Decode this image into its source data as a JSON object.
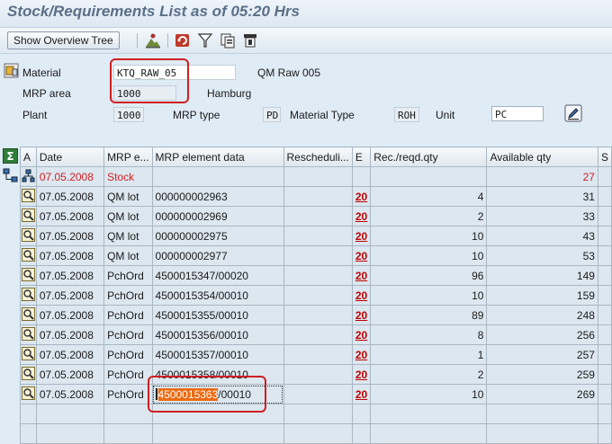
{
  "window": {
    "title": "Stock/Requirements List as of 05:20 Hrs"
  },
  "toolbar": {
    "show_overview_tree": "Show Overview Tree",
    "icons": [
      "person-mountain-icon",
      "refresh-icon",
      "filter-icon",
      "copy-icon",
      "settings-icon"
    ]
  },
  "header": {
    "material_label": "Material",
    "material_value": "KTQ_RAW_05",
    "material_desc": "QM Raw 005",
    "mrp_area_label": "MRP area",
    "mrp_area_value": "1000",
    "mrp_area_desc": "Hamburg",
    "plant_label": "Plant",
    "plant_value": "1000",
    "mrp_type_label": "MRP type",
    "mrp_type_value": "PD",
    "material_type_label": "Material Type",
    "material_type_value": "ROH",
    "unit_label": "Unit",
    "unit_value": "PC"
  },
  "grid": {
    "columns": [
      "A",
      "Date",
      "MRP e...",
      "MRP element data",
      "Rescheduli...",
      "E",
      "Rec./reqd.qty",
      "Available qty",
      "S"
    ],
    "rows": [
      {
        "date": "07.05.2008",
        "element": "Stock",
        "data": "",
        "resched": "",
        "exc": "",
        "qty": "",
        "avail": "27"
      },
      {
        "date": "07.05.2008",
        "element": "QM lot",
        "data": "000000002963",
        "resched": "",
        "exc": "20",
        "qty": "4",
        "avail": "31"
      },
      {
        "date": "07.05.2008",
        "element": "QM lot",
        "data": "000000002969",
        "resched": "",
        "exc": "20",
        "qty": "2",
        "avail": "33"
      },
      {
        "date": "07.05.2008",
        "element": "QM lot",
        "data": "000000002975",
        "resched": "",
        "exc": "20",
        "qty": "10",
        "avail": "43"
      },
      {
        "date": "07.05.2008",
        "element": "QM lot",
        "data": "000000002977",
        "resched": "",
        "exc": "20",
        "qty": "10",
        "avail": "53"
      },
      {
        "date": "07.05.2008",
        "element": "PchOrd",
        "data": "4500015347/00020",
        "resched": "",
        "exc": "20",
        "qty": "96",
        "avail": "149"
      },
      {
        "date": "07.05.2008",
        "element": "PchOrd",
        "data": "4500015354/00010",
        "resched": "",
        "exc": "20",
        "qty": "10",
        "avail": "159"
      },
      {
        "date": "07.05.2008",
        "element": "PchOrd",
        "data": "4500015355/00010",
        "resched": "",
        "exc": "20",
        "qty": "89",
        "avail": "248"
      },
      {
        "date": "07.05.2008",
        "element": "PchOrd",
        "data": "4500015356/00010",
        "resched": "",
        "exc": "20",
        "qty": "8",
        "avail": "256"
      },
      {
        "date": "07.05.2008",
        "element": "PchOrd",
        "data": "4500015357/00010",
        "resched": "",
        "exc": "20",
        "qty": "1",
        "avail": "257"
      },
      {
        "date": "07.05.2008",
        "element": "PchOrd",
        "data": "4500015358/00010",
        "resched": "",
        "exc": "20",
        "qty": "2",
        "avail": "259"
      }
    ],
    "last_row": {
      "date": "07.05.2008",
      "element": "PchOrd",
      "data_highlight": "4500015363",
      "data_rest": "/00010",
      "exc": "20",
      "qty": "10",
      "avail": "269"
    }
  },
  "colors": {
    "accent_red": "#d01f22",
    "highlight_orange": "#ec6a10"
  }
}
